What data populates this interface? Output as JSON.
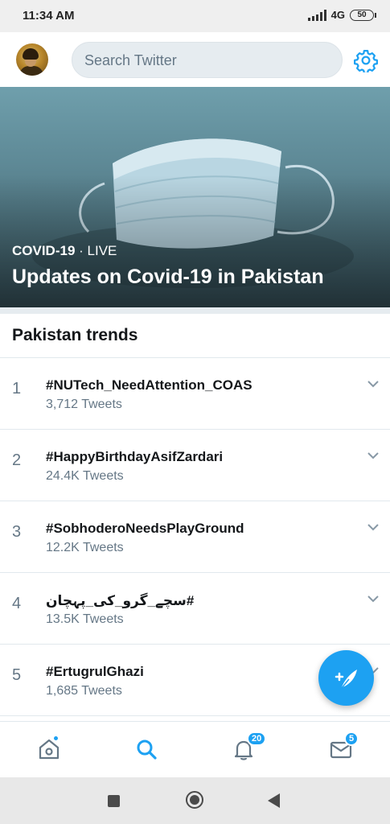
{
  "status_bar": {
    "time": "11:34 AM",
    "network": "4G",
    "battery": "50"
  },
  "header": {
    "search_placeholder": "Search Twitter",
    "avatar_icon": "profile-avatar",
    "settings_icon": "gear-icon"
  },
  "hero": {
    "category": "COVID-19",
    "separator": " · ",
    "live_label": "LIVE",
    "title": "Updates on Covid-19 in Pakistan"
  },
  "trends": {
    "title": "Pakistan trends",
    "items": [
      {
        "rank": "1",
        "name": "#NUTech_NeedAttention_COAS",
        "count": "3,712 Tweets"
      },
      {
        "rank": "2",
        "name": "#HappyBirthdayAsifZardari",
        "count": "24.4K Tweets"
      },
      {
        "rank": "3",
        "name": "#SobhoderoNeedsPlayGround",
        "count": "12.2K Tweets"
      },
      {
        "rank": "4",
        "name": "#سچے_گرو_کی_پہچان",
        "count": "13.5K Tweets"
      },
      {
        "rank": "5",
        "name": "#ErtugrulGhazi",
        "count": "1,685 Tweets"
      }
    ]
  },
  "fab": {
    "icon": "compose-tweet-icon"
  },
  "bottom_nav": {
    "home_icon": "home-icon",
    "search_icon": "search-icon",
    "notifications_icon": "bell-icon",
    "notifications_badge": "20",
    "messages_icon": "mail-icon",
    "messages_badge": "5"
  },
  "colors": {
    "accent": "#1da1f2",
    "text_primary": "#14171a",
    "text_secondary": "#657786"
  }
}
